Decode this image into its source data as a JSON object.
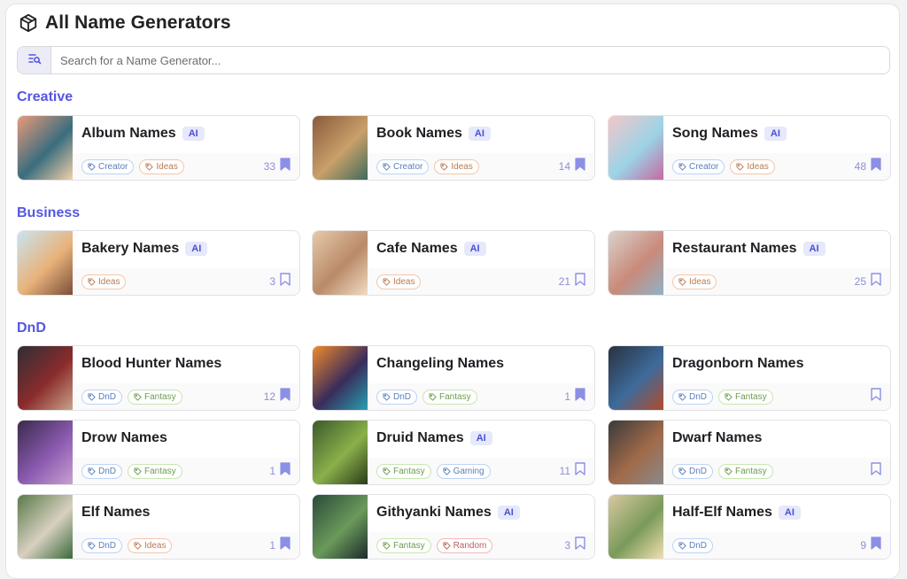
{
  "header": {
    "title": "All Name Generators"
  },
  "search": {
    "placeholder": "Search for a Name Generator..."
  },
  "colors": {
    "accent": "#5457e0",
    "badge_bg": "#e6e8fb"
  },
  "categories": [
    {
      "name": "Creative",
      "items": [
        {
          "title": "Album Names",
          "ai": "AI",
          "tags": [
            {
              "label": "Creator",
              "color": "blue"
            },
            {
              "label": "Ideas",
              "color": "orange"
            }
          ],
          "count": "33",
          "bookmarked": true
        },
        {
          "title": "Book Names",
          "ai": "AI",
          "tags": [
            {
              "label": "Creator",
              "color": "blue"
            },
            {
              "label": "Ideas",
              "color": "orange"
            }
          ],
          "count": "14",
          "bookmarked": true
        },
        {
          "title": "Song Names",
          "ai": "AI",
          "tags": [
            {
              "label": "Creator",
              "color": "blue"
            },
            {
              "label": "Ideas",
              "color": "orange"
            }
          ],
          "count": "48",
          "bookmarked": true
        }
      ]
    },
    {
      "name": "Business",
      "items": [
        {
          "title": "Bakery Names",
          "ai": "AI",
          "tags": [
            {
              "label": "Ideas",
              "color": "orange"
            }
          ],
          "count": "3",
          "bookmarked": false
        },
        {
          "title": "Cafe Names",
          "ai": "AI",
          "tags": [
            {
              "label": "Ideas",
              "color": "orange"
            }
          ],
          "count": "21",
          "bookmarked": false
        },
        {
          "title": "Restaurant Names",
          "ai": "AI",
          "tags": [
            {
              "label": "Ideas",
              "color": "orange"
            }
          ],
          "count": "25",
          "bookmarked": false
        }
      ]
    },
    {
      "name": "DnD",
      "items": [
        {
          "title": "Blood Hunter Names",
          "ai": "",
          "tags": [
            {
              "label": "DnD",
              "color": "blue"
            },
            {
              "label": "Fantasy",
              "color": "green"
            }
          ],
          "count": "12",
          "bookmarked": true
        },
        {
          "title": "Changeling Names",
          "ai": "",
          "tags": [
            {
              "label": "DnD",
              "color": "blue"
            },
            {
              "label": "Fantasy",
              "color": "green"
            }
          ],
          "count": "1",
          "bookmarked": true
        },
        {
          "title": "Dragonborn Names",
          "ai": "",
          "tags": [
            {
              "label": "DnD",
              "color": "blue"
            },
            {
              "label": "Fantasy",
              "color": "green"
            }
          ],
          "count": "",
          "bookmarked": false
        },
        {
          "title": "Drow Names",
          "ai": "",
          "tags": [
            {
              "label": "DnD",
              "color": "blue"
            },
            {
              "label": "Fantasy",
              "color": "green"
            }
          ],
          "count": "1",
          "bookmarked": true
        },
        {
          "title": "Druid Names",
          "ai": "AI",
          "tags": [
            {
              "label": "Fantasy",
              "color": "green"
            },
            {
              "label": "Gaming",
              "color": "blue"
            }
          ],
          "count": "11",
          "bookmarked": false
        },
        {
          "title": "Dwarf Names",
          "ai": "",
          "tags": [
            {
              "label": "DnD",
              "color": "blue"
            },
            {
              "label": "Fantasy",
              "color": "green"
            }
          ],
          "count": "",
          "bookmarked": false
        },
        {
          "title": "Elf Names",
          "ai": "",
          "tags": [
            {
              "label": "DnD",
              "color": "blue"
            },
            {
              "label": "Ideas",
              "color": "orange"
            }
          ],
          "count": "1",
          "bookmarked": true
        },
        {
          "title": "Githyanki Names",
          "ai": "AI",
          "tags": [
            {
              "label": "Fantasy",
              "color": "green"
            },
            {
              "label": "Random",
              "color": "red"
            }
          ],
          "count": "3",
          "bookmarked": false
        },
        {
          "title": "Half-Elf Names",
          "ai": "AI",
          "tags": [
            {
              "label": "DnD",
              "color": "blue"
            }
          ],
          "count": "9",
          "bookmarked": true
        }
      ]
    }
  ]
}
